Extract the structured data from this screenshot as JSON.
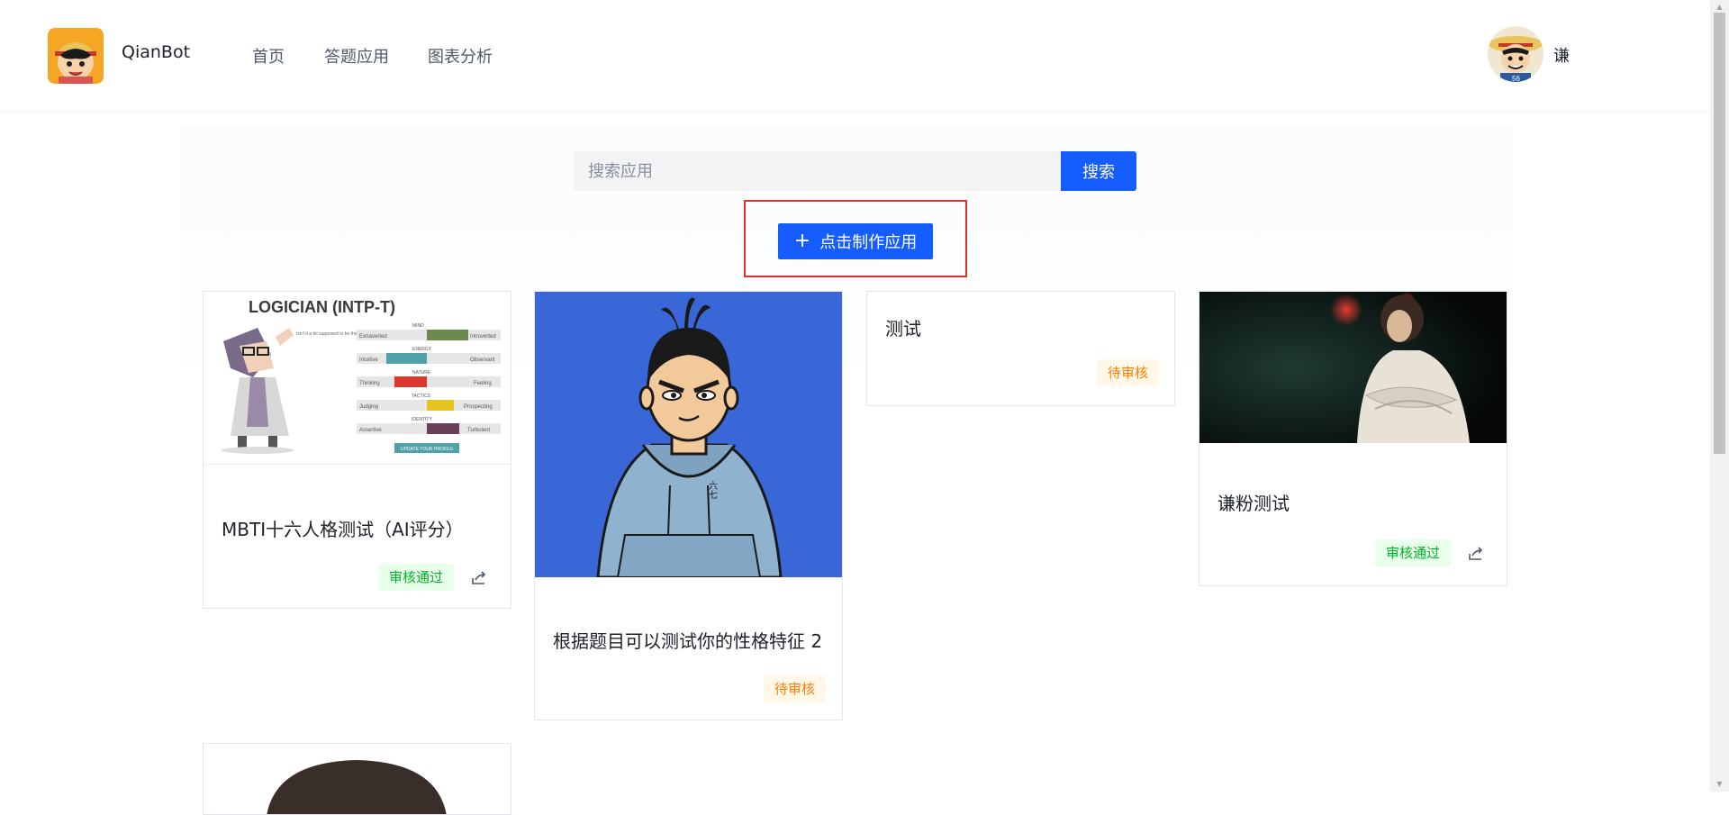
{
  "header": {
    "brand": "QianBot",
    "nav": [
      "首页",
      "答题应用",
      "图表分析"
    ],
    "user_name": "谦"
  },
  "search": {
    "placeholder": "搜索应用",
    "button_label": "搜索"
  },
  "create_button_label": "点击制作应用",
  "cards": [
    {
      "title": "MBTI十六人格测试（AI评分）",
      "status": "审核通过",
      "cover": {
        "heading": "LOGICIAN (INTP-T)",
        "bubble": "Isn't it a bit supposed to be this...",
        "traits": [
          {
            "section": "MIND",
            "left": "Extraverted",
            "right": "Introverted"
          },
          {
            "section": "ENERGY",
            "left": "Intuitive",
            "right": "Observant"
          },
          {
            "section": "NATURE",
            "left": "Thinking",
            "right": "Feeling"
          },
          {
            "section": "TACTICS",
            "left": "Judging",
            "right": "Prospecting"
          },
          {
            "section": "IDENTITY",
            "left": "Assertive",
            "right": "Turbulent"
          }
        ],
        "cta": "UPDATE YOUR PROFILE"
      }
    },
    {
      "title": "根据题目可以测试你的性格特征 2",
      "status": "待审核",
      "hoodie_text": "六七"
    },
    {
      "title": "测试",
      "status": "待审核"
    },
    {
      "title": "谦粉测试",
      "status": "审核通过"
    }
  ],
  "colors": {
    "primary": "#165dff",
    "success": "#00b42a",
    "warning": "#ff7d00",
    "highlight": "#e03030"
  }
}
